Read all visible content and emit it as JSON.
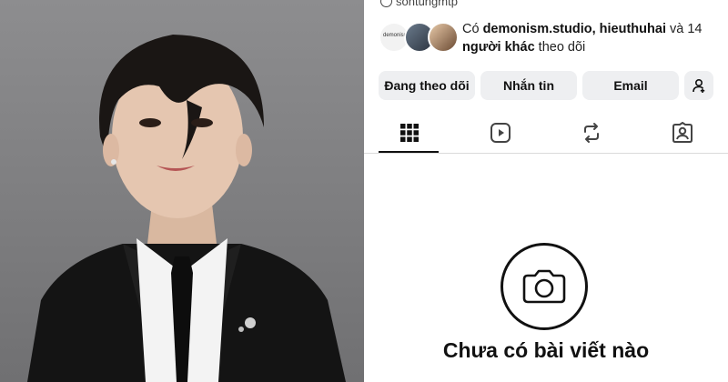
{
  "profile": {
    "handle": "sontungmtp"
  },
  "followers": {
    "avatar1_text": "demonism",
    "prefix": "Có ",
    "names": "demonism.studio, hieuthuhai",
    "suffix_and": " và 14",
    "others": "người khác",
    "suffix": " theo dõi"
  },
  "buttons": {
    "following": "Đang theo dõi",
    "message": "Nhắn tin",
    "email": "Email"
  },
  "tabs": [
    {
      "icon": "grid-icon"
    },
    {
      "icon": "reels-icon"
    },
    {
      "icon": "repost-icon"
    },
    {
      "icon": "tagged-icon"
    }
  ],
  "empty_state": {
    "icon": "camera-icon",
    "title": "Chưa có bài viết nào"
  },
  "colors": {
    "button_bg": "#eeeff1",
    "text": "#111111",
    "divider": "#dbdbdb"
  }
}
